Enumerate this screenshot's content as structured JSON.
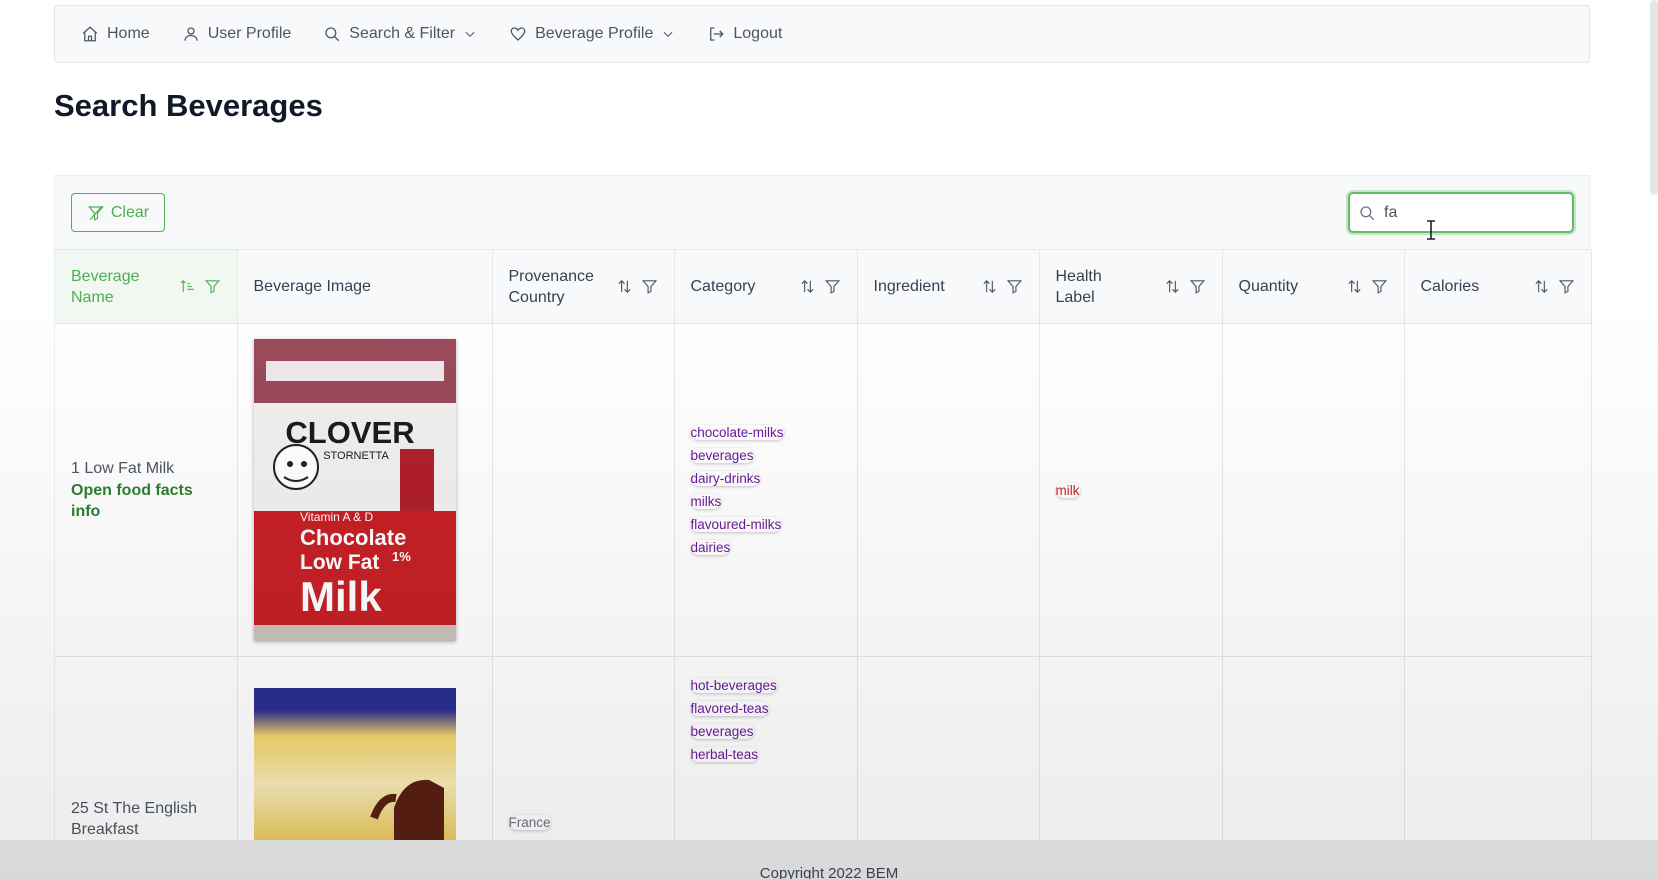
{
  "nav": {
    "home": "Home",
    "user_profile": "User Profile",
    "search_filter": "Search & Filter",
    "beverage_profile": "Beverage Profile",
    "logout": "Logout"
  },
  "page_title": "Search Beverages",
  "toolbar": {
    "clear_label": "Clear",
    "search_value": "fa"
  },
  "table": {
    "columns": [
      "Beverage Name",
      "Beverage Image",
      "Provenance Country",
      "Category",
      "Ingredient",
      "Health Label",
      "Quantity",
      "Calories"
    ],
    "rows": [
      {
        "name": "1 Low Fat Milk",
        "link": "Open food facts info",
        "country": "",
        "categories": [
          "chocolate-milks",
          "beverages",
          "dairy-drinks",
          "milks",
          "flavoured-milks",
          "dairies"
        ],
        "health_labels": [
          "milk"
        ],
        "image_text": {
          "brand": "CLOVER",
          "sub": "STORNETTA",
          "vitamin": "Vitamin A & D",
          "line1": "Chocolate",
          "line2": "Low Fat",
          "pct": "1%",
          "line3": "Milk"
        }
      },
      {
        "name": "25 St The English Breakfast",
        "country": "France",
        "categories": [
          "hot-beverages",
          "flavored-teas",
          "beverages",
          "herbal-teas"
        ],
        "health_labels": []
      }
    ]
  },
  "footer": "Copyright 2022 BEM",
  "colors": {
    "accent": "#4caf50",
    "chip_text": "#6a1b9a",
    "health_chip": "#c62828"
  }
}
